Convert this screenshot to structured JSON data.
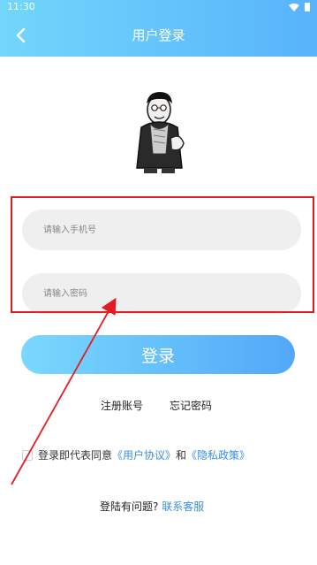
{
  "status_bar": {
    "time": "11:30",
    "icons": [
      "wifi-icon",
      "battery-icon"
    ]
  },
  "header": {
    "title": "用户登录",
    "back_icon": "chevron-left-icon"
  },
  "form": {
    "phone_placeholder": "请输入手机号",
    "password_placeholder": "请输入密码"
  },
  "actions": {
    "login_label": "登录",
    "register_label": "注册账号",
    "forgot_label": "忘记密码"
  },
  "agreement": {
    "prefix": "登录即代表同意",
    "user_agreement": "《用户协议》",
    "and": "和",
    "privacy_policy": "《隐私政策》"
  },
  "help": {
    "question": "登陆有问题?",
    "contact": "联系客服"
  },
  "colors": {
    "header_start": "#72d6fb",
    "header_end": "#58b3fb",
    "button_start": "#7ad8fd",
    "button_end": "#52a8f8",
    "link_blue": "#3c8ee6",
    "annotation_red": "#e41b23"
  }
}
